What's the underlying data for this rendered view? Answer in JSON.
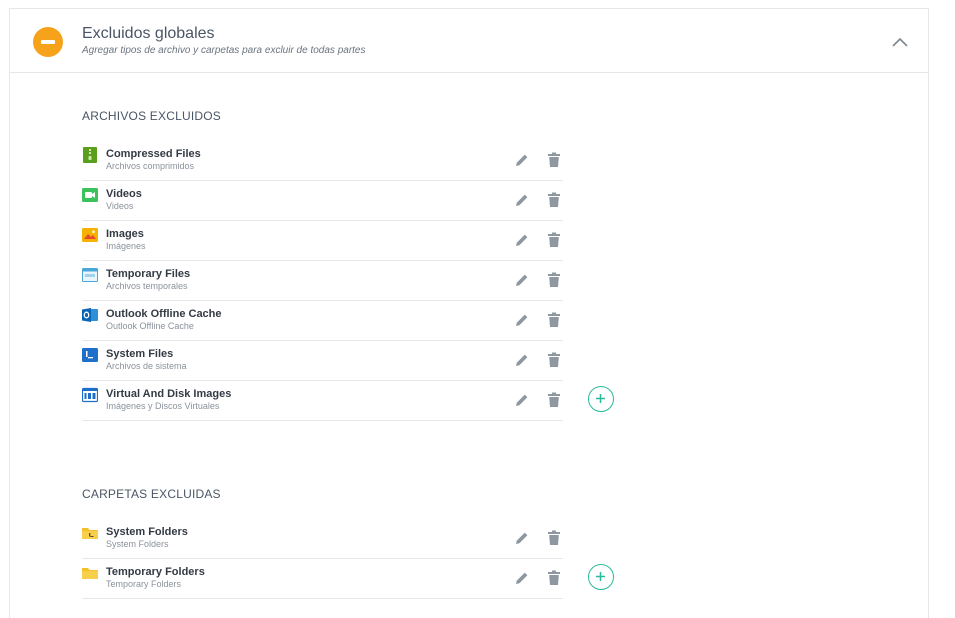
{
  "header": {
    "title": "Excluidos globales",
    "subtitle": "Agregar tipos de archivo y carpetas para excluir de todas partes",
    "status_icon": "minus-circle-icon",
    "status_color": "#f7a21b",
    "collapse_icon": "chevron-up-icon"
  },
  "files_section": {
    "title": "ARCHIVOS EXCLUIDOS",
    "items": [
      {
        "name": "Compressed Files",
        "desc": "Archivos comprimidos",
        "icon": "zip-file-icon"
      },
      {
        "name": "Videos",
        "desc": "Videos",
        "icon": "video-file-icon"
      },
      {
        "name": "Images",
        "desc": "Imágenes",
        "icon": "image-file-icon"
      },
      {
        "name": "Temporary Files",
        "desc": "Archivos temporales",
        "icon": "tmp-file-icon"
      },
      {
        "name": "Outlook Offline Cache",
        "desc": "Outlook Offline Cache",
        "icon": "outlook-icon"
      },
      {
        "name": "System Files",
        "desc": "Archivos de sistema",
        "icon": "system-file-icon"
      },
      {
        "name": "Virtual And Disk Images",
        "desc": "Imágenes y Discos Virtuales",
        "icon": "iso-file-icon"
      }
    ]
  },
  "folders_section": {
    "title": "CARPETAS EXCLUIDAS",
    "items": [
      {
        "name": "System Folders",
        "desc": "System Folders",
        "icon": "system-folder-icon"
      },
      {
        "name": "Temporary Folders",
        "desc": "Temporary Folders",
        "icon": "folder-icon"
      }
    ]
  },
  "colors": {
    "accent_add": "#2bb99c",
    "action_icon": "#8f97a1",
    "divider": "#e4e6e9"
  }
}
